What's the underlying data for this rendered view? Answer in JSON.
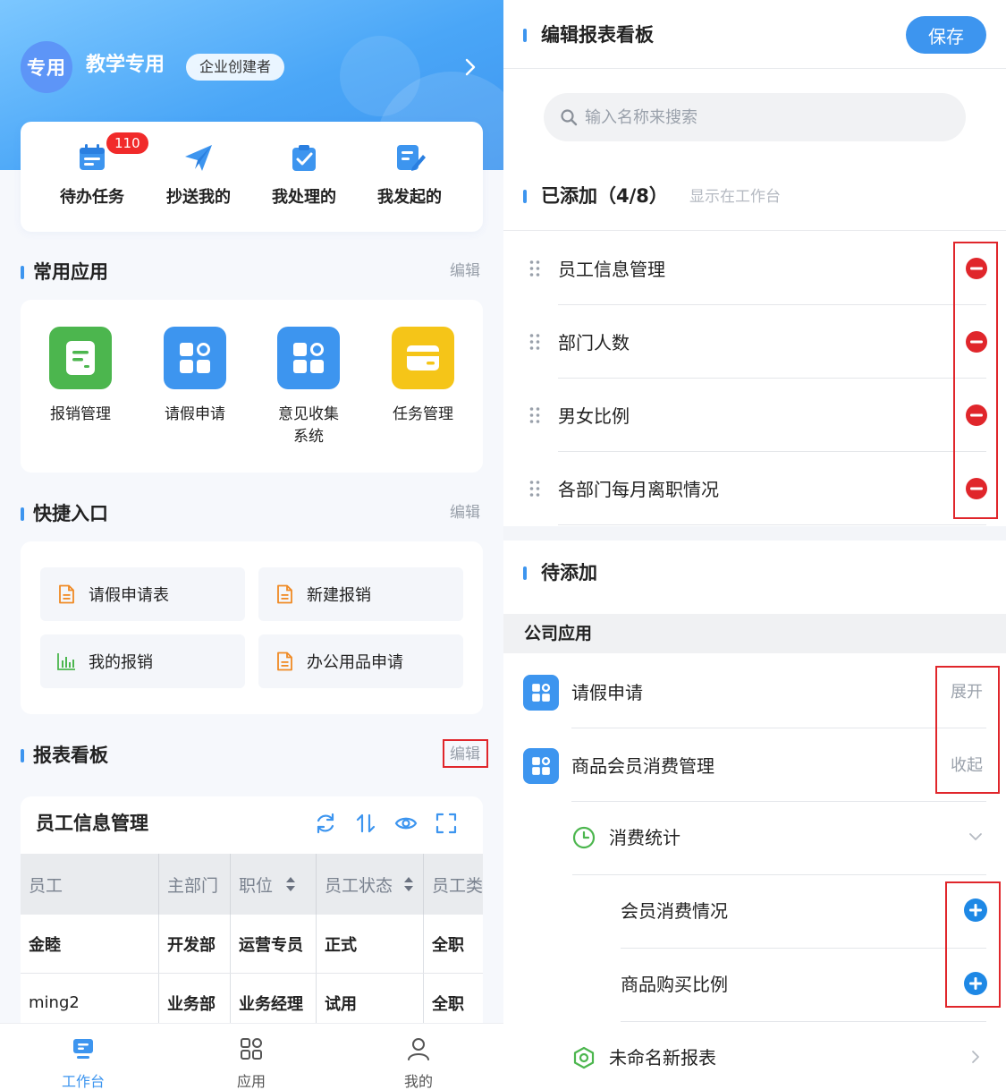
{
  "left": {
    "org": {
      "avatar_text": "专用",
      "name": "教学专用",
      "role_badge": "企业创建者"
    },
    "tasks": [
      {
        "label": "待办任务",
        "icon": "calendar-icon",
        "badge": "110"
      },
      {
        "label": "抄送我的",
        "icon": "paper-plane-icon"
      },
      {
        "label": "我处理的",
        "icon": "clipboard-check-icon"
      },
      {
        "label": "我发起的",
        "icon": "edit-doc-icon"
      }
    ],
    "common_apps": {
      "title": "常用应用",
      "edit": "编辑",
      "items": [
        {
          "label": "报销管理",
          "icon": "expense-icon",
          "color": "#4cb64e"
        },
        {
          "label": "请假申请",
          "icon": "apps-grid-icon",
          "color": "#3d95ef"
        },
        {
          "label": "意见收集\n系统",
          "icon": "apps-grid-icon",
          "color": "#3d95ef"
        },
        {
          "label": "任务管理",
          "icon": "card-icon",
          "color": "#f5c518"
        }
      ]
    },
    "quick_entry": {
      "title": "快捷入口",
      "edit": "编辑",
      "items": [
        {
          "label": "请假申请表",
          "icon": "document-icon"
        },
        {
          "label": "新建报销",
          "icon": "document-icon"
        },
        {
          "label": "我的报销",
          "icon": "bar-chart-icon"
        },
        {
          "label": "办公用品申请",
          "icon": "document-icon"
        }
      ]
    },
    "report_board": {
      "title": "报表看板",
      "edit": "编辑",
      "card_title": "员工信息管理",
      "tools": [
        "refresh-icon",
        "sort-icon",
        "eye-icon",
        "fullscreen-icon"
      ],
      "columns": [
        "员工",
        "主部门",
        "职位",
        "员工状态",
        "员工类"
      ],
      "rows": [
        [
          "金睦",
          "开发部",
          "运营专员",
          "正式",
          "全职"
        ],
        [
          "ming2",
          "业务部",
          "业务经理",
          "试用",
          "全职"
        ]
      ]
    },
    "tabbar": [
      {
        "label": "工作台",
        "icon": "workbench-icon",
        "active": true
      },
      {
        "label": "应用",
        "icon": "apps-icon",
        "active": false
      },
      {
        "label": "我的",
        "icon": "user-icon",
        "active": false
      }
    ]
  },
  "right": {
    "title": "编辑报表看板",
    "save_label": "保存",
    "search_placeholder": "输入名称来搜索",
    "added": {
      "title": "已添加（4/8）",
      "hint": "显示在工作台",
      "items": [
        "员工信息管理",
        "部门人数",
        "男女比例",
        "各部门每月离职情况"
      ]
    },
    "pending": {
      "title": "待添加",
      "group": "公司应用",
      "apps": [
        {
          "label": "请假申请",
          "action": "展开"
        },
        {
          "label": "商品会员消费管理",
          "action": "收起"
        }
      ],
      "sub": {
        "label": "消费统计"
      },
      "leaves": [
        "会员消费情况",
        "商品购买比例"
      ],
      "new_report": "未命名新报表"
    }
  },
  "colors": {
    "accent": "#3d95ef",
    "danger": "#e0262b",
    "success": "#4cb64e",
    "warning": "#f5c518",
    "orange": "#f08a24"
  }
}
